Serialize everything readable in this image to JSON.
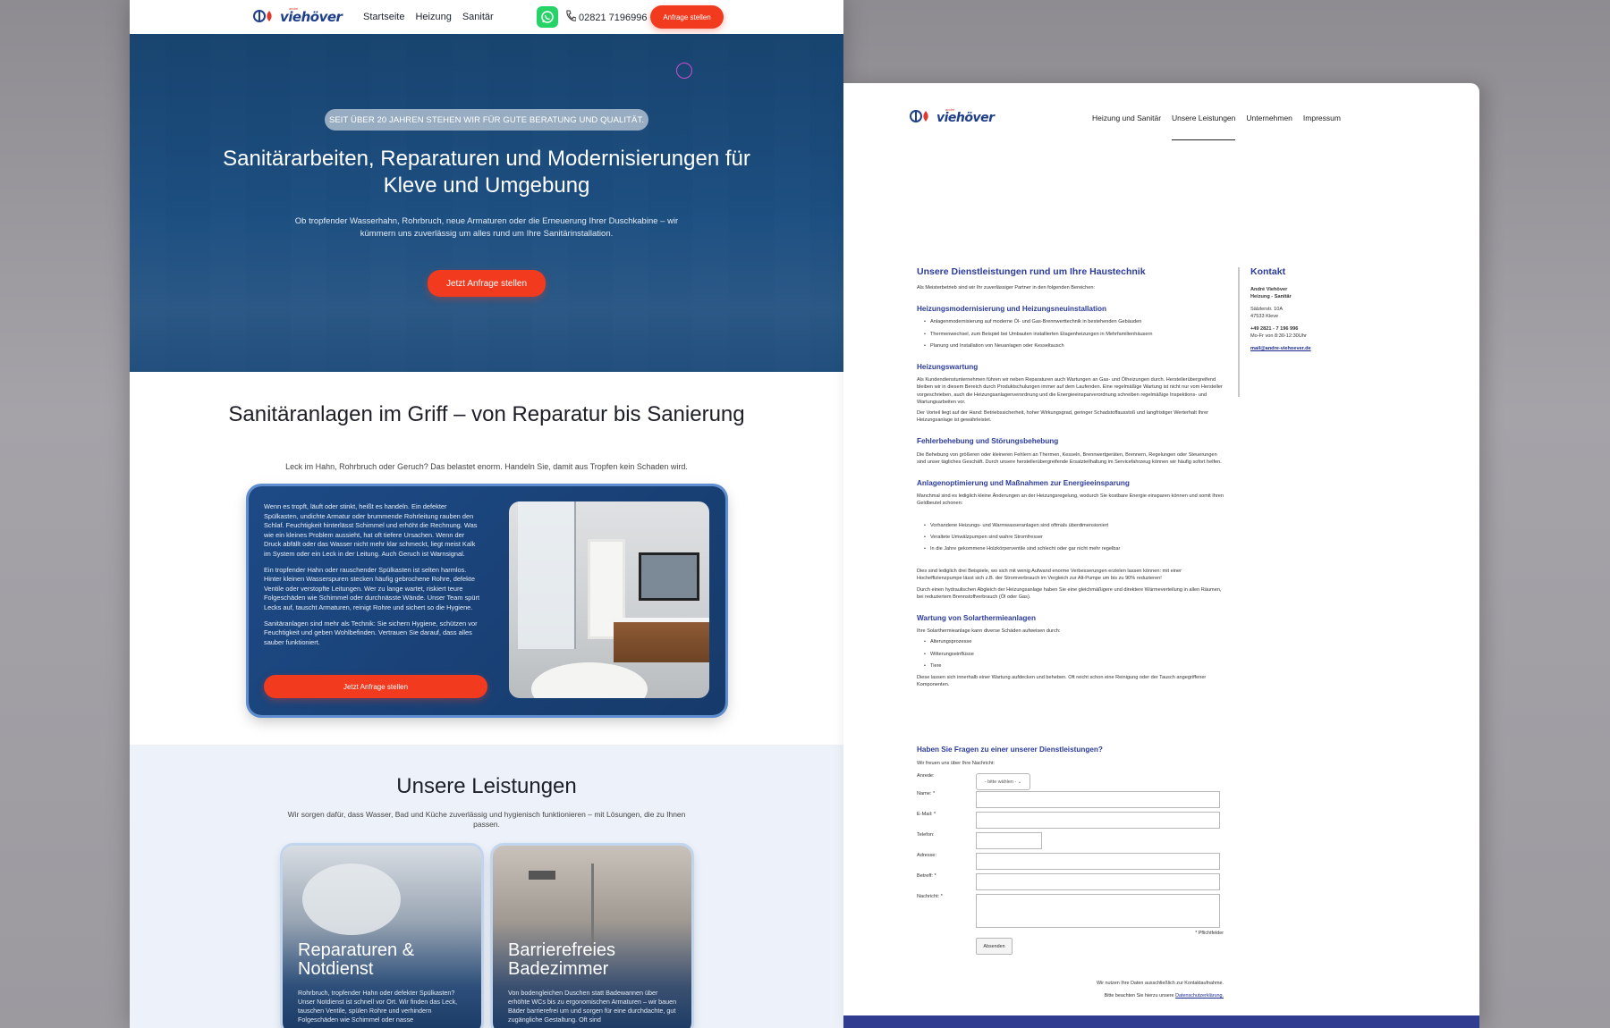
{
  "left_site": {
    "logo": {
      "small": "andré",
      "main": "viehöver"
    },
    "nav": [
      "Startseite",
      "Heizung",
      "Sanitär"
    ],
    "phone": "02821 7196996",
    "header_cta": "Anfrage stellen",
    "hero": {
      "badge": "SEIT ÜBER 20 JAHREN STEHEN WIR FÜR GUTE BERATUNG UND QUALITÄT.",
      "title": "Sanitärarbeiten, Reparaturen und Modernisierungen für Kleve und Umgebung",
      "subtitle": "Ob tropfender Wasserhahn, Rohrbruch, neue Armaturen oder die Erneuerung Ihrer Duschkabine – wir kümmern uns zuverlässig um alles rund um Ihre Sanitärinstallation.",
      "cta": "Jetzt Anfrage stellen"
    },
    "section2": {
      "title": "Sanitäranlagen im Griff – von Reparatur bis Sanierung",
      "subtitle": "Leck im Hahn, Rohrbruch oder Geruch? Das belastet enorm. Handeln Sie, damit aus Tropfen kein Schaden wird.",
      "paragraphs": [
        "Wenn es tropft, läuft oder stinkt, heißt es handeln. Ein defekter Spülkasten, undichte Armatur oder brummende Rohrleitung rauben den Schlaf. Feuchtigkeit hinterlässt Schimmel und erhöht die Rechnung. Was wie ein kleines Problem aussieht, hat oft tiefere Ursachen. Wenn der Druck abfällt oder das Wasser nicht mehr klar schmeckt, liegt meist Kalk im System oder ein Leck in der Leitung. Auch Geruch ist Warnsignal.",
        "Ein tropfender Hahn oder rauschender Spülkasten ist selten harmlos. Hinter kleinen Wasserspuren stecken häufig gebrochene Rohre, defekte Ventile oder verstopfte Leitungen. Wer zu lange wartet, riskiert teure Folgeschäden wie Schimmel oder durchnässte Wände. Unser Team spürt Lecks auf, tauscht Armaturen, reinigt Rohre und sichert so die Hygiene.",
        "Sanitäranlagen sind mehr als Technik: Sie sichern Hygiene, schützen vor Feuchtigkeit und geben Wohlbefinden. Vertrauen Sie darauf, dass alles sauber funktioniert."
      ],
      "cta": "Jetzt Anfrage stellen"
    },
    "leistungen": {
      "title": "Unsere Leistungen",
      "subtitle": "Wir sorgen dafür, dass Wasser, Bad und Küche zuverlässig und hygienisch funktionieren – mit Lösungen, die zu Ihnen passen.",
      "cards": [
        {
          "title": "Reparaturen & Notdienst",
          "text": "Rohrbruch, tropfender Hahn oder defekter Spülkasten? Unser Notdienst ist schnell vor Ort. Wir finden das Leck, tauschen Ventile, spülen Rohre und verhindern Folgeschäden wie Schimmel oder nasse"
        },
        {
          "title": "Barrierefreies Badezimmer",
          "text": "Von bodengleichen Duschen statt Badewannen über erhöhte WCs bis zu ergonomischen Armaturen – wir bauen Bäder barrierefrei um und sorgen für eine durchdachte, gut zugängliche Gestaltung. Oft sind"
        }
      ]
    }
  },
  "right_site": {
    "logo": {
      "small": "andré",
      "main": "viehöver"
    },
    "nav": [
      "Heizung und Sanitär",
      "Unsere Leistungen",
      "Unternehmen",
      "Impressum"
    ],
    "active_nav": "Unsere Leistungen",
    "title": "Unsere Dienstleistungen rund um Ihre Haustechnik",
    "intro": "Als Meisterbetrieb sind wir Ihr zuverlässiger Partner in den folgenden Bereichen:",
    "sections": [
      {
        "heading": "Heizungsmodernisierung und Heizungsneuinstallation",
        "bullets": [
          "Anlagenmodernisierung auf moderne Öl- und Gas-Brennwerttechnik in bestehenden Gebäuden",
          "Thermenwechsel, zum Beispiel bei Umbauten installierten Etagenheizungen in Mehrfamilienhäusern",
          "Planung und Installation von Neuanlagen oder Kesseltausch"
        ]
      },
      {
        "heading": "Heizungswartung",
        "paragraphs": [
          "Als Kundendienstunternehmen führen wir neben Reparaturen auch Wartungen an Gas- und Ölheizungen durch. Herstellerübergreifend bleiben wir in diesem Bereich durch Produktschulungen immer auf dem Laufenden. Eine regelmäßige Wartung ist nicht nur vom Hersteller vorgeschrieben, auch die Heizungsanlagenverordnung und die Energieeinsparverordnung schreiben regelmäßige Inspektions- und Wartungsarbeiten vor.",
          "Der Vorteil liegt auf der Hand: Betriebssicherheit, hoher Wirkungsgrad, geringer Schadstoffausstoß und langfristiger Werterhalt Ihrer Heizungsanlage ist gewährleistet."
        ]
      },
      {
        "heading": "Fehlerbehebung und Störungsbehebung",
        "paragraphs": [
          "Die Behebung von größeren oder kleineren Fehlern an Thermen, Kesseln, Brennwertgeräten, Brennern, Regelungen oder Steuerungen sind unser tägliches Geschäft. Durch unsere herstellerübergreifende Ersatzteilhaltung im Servicefahrzeug können wir häufig sofort helfen."
        ]
      },
      {
        "heading": "Anlagenoptimierung und Maßnahmen zur Energieeinsparung",
        "paragraphs": [
          "Manchmal sind es lediglich kleine Änderungen an der Heizungsregelung, wodurch Sie kostbare Energie einsparen können und somit Ihren Geldbeutel schonen:"
        ],
        "bullets": [
          "Vorhandene Heizungs- und Warmwasseranlagen sind oftmals überdimensioniert",
          "Veraltete Umwälzpumpen sind wahre Stromfresser",
          "In die Jahre gekommene Holzkörperventile sind schlecht oder gar nicht mehr regelbar"
        ],
        "after": [
          "Dies sind lediglich drei Beispiele, wo sich mit wenig Aufwand enorme Verbesserungen erzielen lassen können: mit einer Hocheffizienzpumpe lässt sich z.B. der Stromverbrauch im Vergleich zur Alt-Pumpe um bis zu 90% reduzieren!",
          "Durch einen hydraulischen Abgleich der Heizungsanlage haben Sie eine gleichmäßigere und direktere Wärmeverteilung in allen Räumen, bei reduziertem Brennstoffverbrauch (Öl oder Gas)."
        ]
      },
      {
        "heading": "Wartung von Solarthermieanlagen",
        "paragraphs": [
          "Ihre Solarthermieanlage kann diverse Schäden aufweisen durch:"
        ],
        "bullets": [
          "Alterungsprozesse",
          "Witterungseinflüsse",
          "Tiere"
        ],
        "after": [
          "Diese lassen sich innerhalb einer Wartung aufdecken und beheben. Oft reicht schon eine Reinigung oder der Tausch angegriffener Komponenten."
        ]
      }
    ],
    "sidebar": {
      "title": "Kontakt",
      "name": "André Viehöver",
      "line2": "Heizung - Sanitär",
      "street": "Sälzlerstr. 10A",
      "city": "47533 Kleve",
      "phone": "+49 2821 - 7 196 996",
      "hours": "Mo-Fr von 8:30-12:30Uhr",
      "email": "mail@andre-viehoever.de"
    },
    "form": {
      "title": "Haben Sie Fragen zu einer unserer Dienstleistungen?",
      "intro": "Wir freuen uns über Ihre Nachricht:",
      "labels": [
        "Anrede:",
        "Name: *",
        "E-Mail: *",
        "Telefon:",
        "Adresse:",
        "Betreff: *",
        "Nachricht: *"
      ],
      "select_value": "- bitte wählen -",
      "required_note": "* Pflichtfelder",
      "submit": "Absenden",
      "privacy1": "Wir nutzen Ihre Daten ausschließlich zur Kontaktaufnahme.",
      "privacy2_prefix": "Bitte beachten Sie hierzu unsere",
      "privacy2_link": "Datenschutzerklärung."
    }
  }
}
